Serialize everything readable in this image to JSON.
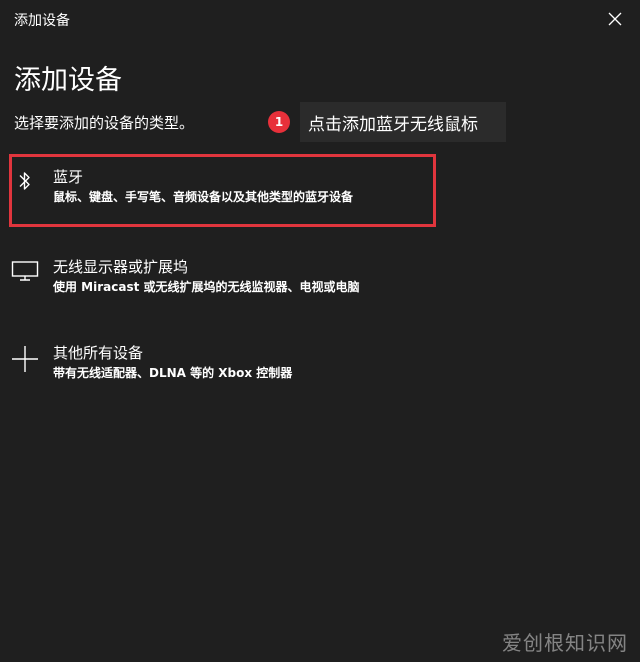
{
  "window": {
    "title": "添加设备"
  },
  "main": {
    "heading": "添加设备",
    "subtitle": "选择要添加的设备的类型。"
  },
  "callout": {
    "badge": "1",
    "text": "点击添加蓝牙无线鼠标",
    "badge_color": "#e8303a"
  },
  "options": [
    {
      "title": "蓝牙",
      "description": "鼠标、键盘、手写笔、音频设备以及其他类型的蓝牙设备",
      "icon": "bluetooth-icon"
    },
    {
      "title": "无线显示器或扩展坞",
      "description": "使用 Miracast 或无线扩展坞的无线监视器、电视或电脑",
      "icon": "monitor-icon"
    },
    {
      "title": "其他所有设备",
      "description": "带有无线适配器、DLNA 等的 Xbox 控制器",
      "icon": "plus-icon"
    }
  ],
  "highlight_color": "#e0353d",
  "watermark": "爱创根知识网"
}
